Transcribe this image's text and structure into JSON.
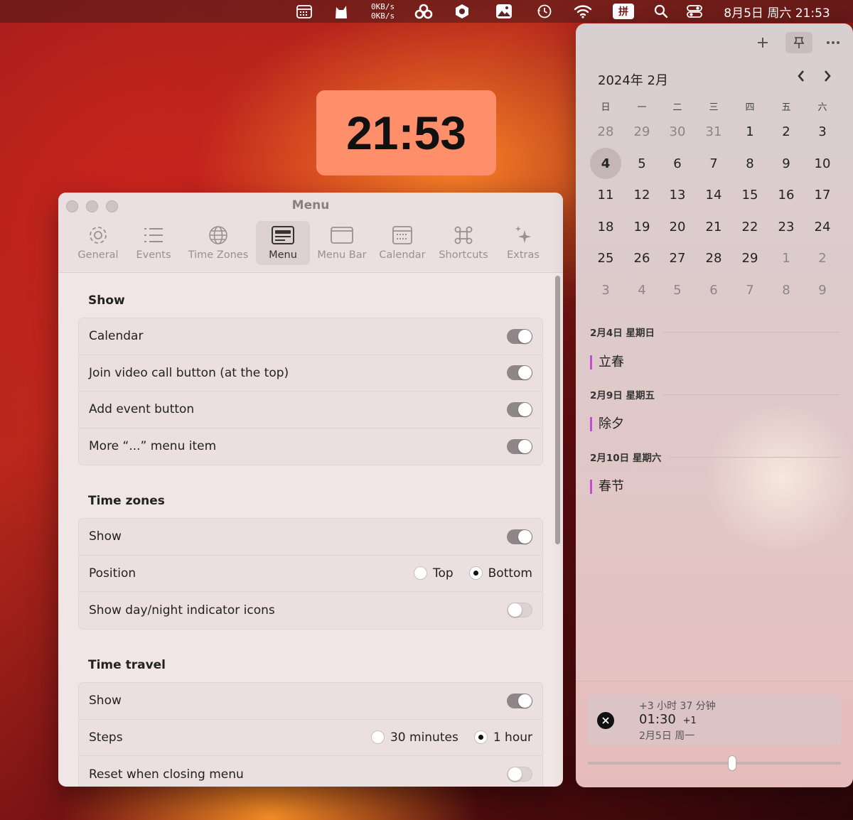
{
  "menubar": {
    "net_up": "0KB/s",
    "net_down": "0KB/s",
    "ime": "拼",
    "clock": "8月5日 周六  21:53"
  },
  "clock_widget": {
    "time": "21:53"
  },
  "settings": {
    "title": "Menu",
    "tabs": [
      {
        "label": "General",
        "icon": "gear-icon"
      },
      {
        "label": "Events",
        "icon": "list-icon"
      },
      {
        "label": "Time Zones",
        "icon": "globe-icon"
      },
      {
        "label": "Menu",
        "icon": "menu-icon",
        "active": true
      },
      {
        "label": "Menu Bar",
        "icon": "window-icon"
      },
      {
        "label": "Calendar",
        "icon": "calendar-icon"
      },
      {
        "label": "Shortcuts",
        "icon": "command-icon"
      },
      {
        "label": "Extras",
        "icon": "sparkles-icon"
      }
    ],
    "show": {
      "title": "Show",
      "items": [
        {
          "label": "Calendar",
          "on": true
        },
        {
          "label": "Join video call button (at the top)",
          "on": true
        },
        {
          "label": "Add event button",
          "on": true
        },
        {
          "label": "More “...” menu item",
          "on": true
        }
      ]
    },
    "timezones": {
      "title": "Time zones",
      "show_label": "Show",
      "show_on": true,
      "position_label": "Position",
      "position_options": [
        "Top",
        "Bottom"
      ],
      "position_selected": "Bottom",
      "daynight_label": "Show day/night indicator icons",
      "daynight_on": false
    },
    "timetravel": {
      "title": "Time travel",
      "show_label": "Show",
      "show_on": true,
      "steps_label": "Steps",
      "steps_options": [
        "30 minutes",
        "1 hour"
      ],
      "steps_selected": "1 hour",
      "reset_label": "Reset when closing menu",
      "reset_on": false
    }
  },
  "calendar": {
    "month_label": "2024年 2月",
    "weekdays": [
      "日",
      "一",
      "二",
      "三",
      "四",
      "五",
      "六"
    ],
    "weeks": [
      [
        {
          "d": "28",
          "m": true
        },
        {
          "d": "29",
          "m": true
        },
        {
          "d": "30",
          "m": true
        },
        {
          "d": "31",
          "m": true
        },
        {
          "d": "1"
        },
        {
          "d": "2"
        },
        {
          "d": "3"
        }
      ],
      [
        {
          "d": "4",
          "t": true
        },
        {
          "d": "5"
        },
        {
          "d": "6"
        },
        {
          "d": "7"
        },
        {
          "d": "8"
        },
        {
          "d": "9"
        },
        {
          "d": "10"
        }
      ],
      [
        {
          "d": "11"
        },
        {
          "d": "12"
        },
        {
          "d": "13"
        },
        {
          "d": "14"
        },
        {
          "d": "15"
        },
        {
          "d": "16"
        },
        {
          "d": "17"
        }
      ],
      [
        {
          "d": "18"
        },
        {
          "d": "19"
        },
        {
          "d": "20"
        },
        {
          "d": "21"
        },
        {
          "d": "22"
        },
        {
          "d": "23"
        },
        {
          "d": "24"
        }
      ],
      [
        {
          "d": "25"
        },
        {
          "d": "26"
        },
        {
          "d": "27"
        },
        {
          "d": "28"
        },
        {
          "d": "29"
        },
        {
          "d": "1",
          "m": true
        },
        {
          "d": "2",
          "m": true
        }
      ],
      [
        {
          "d": "3",
          "m": true
        },
        {
          "d": "4",
          "m": true
        },
        {
          "d": "5",
          "m": true
        },
        {
          "d": "6",
          "m": true
        },
        {
          "d": "7",
          "m": true
        },
        {
          "d": "8",
          "m": true
        },
        {
          "d": "9",
          "m": true
        }
      ]
    ],
    "events": [
      {
        "date": "2月4日  星期日",
        "title": "立春"
      },
      {
        "date": "2月9日  星期五",
        "title": "除夕"
      },
      {
        "date": "2月10日  星期六",
        "title": "春节"
      }
    ],
    "event_color": "#c44bd6",
    "time_travel": {
      "offset": "+3 小时 37 分钟",
      "time": "01:30",
      "day_offset": "+1",
      "date": "2月5日 周一",
      "slider_fraction": 0.57
    }
  }
}
